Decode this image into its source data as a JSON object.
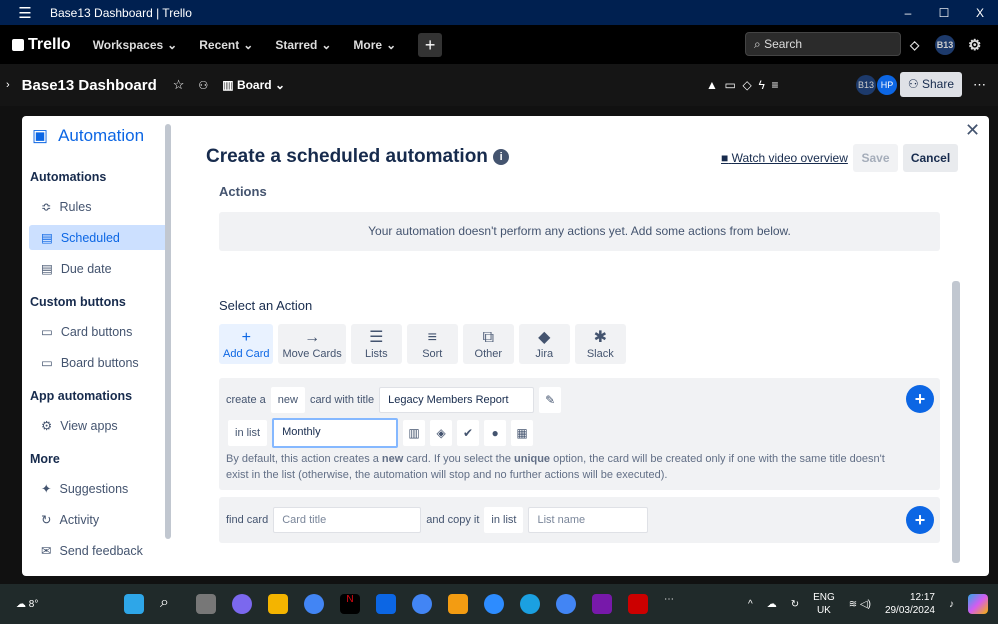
{
  "window": {
    "title": "Base13 Dashboard | Trello",
    "minimize": "–",
    "maximize": "☐",
    "close": "X"
  },
  "topnav": {
    "logo": "Trello",
    "items": [
      "Workspaces",
      "Recent",
      "Starred",
      "More"
    ],
    "search_placeholder": "Search",
    "avatar": "B13"
  },
  "board": {
    "title": "Base13 Dashboard",
    "view": "Board",
    "members": [
      "B13",
      "HP"
    ],
    "share": "Share"
  },
  "sidebar": {
    "title": "Automation",
    "sections": [
      {
        "label": "Automations",
        "items": [
          {
            "label": "Rules",
            "icon": "≎"
          },
          {
            "label": "Scheduled",
            "icon": "▤",
            "active": true
          },
          {
            "label": "Due date",
            "icon": "▤"
          }
        ]
      },
      {
        "label": "Custom buttons",
        "items": [
          {
            "label": "Card buttons",
            "icon": "▭"
          },
          {
            "label": "Board buttons",
            "icon": "▭"
          }
        ]
      },
      {
        "label": "App automations",
        "items": [
          {
            "label": "View apps",
            "icon": "⚙"
          }
        ]
      },
      {
        "label": "More",
        "items": [
          {
            "label": "Suggestions",
            "icon": "✦"
          },
          {
            "label": "Activity",
            "icon": "↻"
          },
          {
            "label": "Send feedback",
            "icon": "✉"
          }
        ]
      }
    ]
  },
  "main": {
    "title": "Create a scheduled automation",
    "watch": "Watch video overview",
    "save": "Save",
    "cancel": "Cancel",
    "actions_heading": "Actions",
    "empty": "Your automation doesn't perform any actions yet. Add some actions from below.",
    "select_heading": "Select an Action",
    "tabs": [
      {
        "label": "Add Card",
        "icon": "+"
      },
      {
        "label": "Move Cards",
        "icon": "→"
      },
      {
        "label": "Lists",
        "icon": "☰"
      },
      {
        "label": "Sort",
        "icon": "≡"
      },
      {
        "label": "Other",
        "icon": "⧉"
      },
      {
        "label": "Jira",
        "icon": "◆"
      },
      {
        "label": "Slack",
        "icon": "✱"
      }
    ],
    "create": {
      "create_a": "create a",
      "new": "new",
      "card_with_title": "card with title",
      "title_value": "Legacy Members Report",
      "in_list": "in list",
      "list_value": "Monthly",
      "desc_1": "By default, this action creates a ",
      "desc_new": "new",
      "desc_2": " card. If you select the ",
      "desc_unique": "unique",
      "desc_3": " option, the card will be created only if one with the same title doesn't exist in the list (otherwise, the automation will stop and no further actions will be executed)."
    },
    "copy": {
      "find_card": "find card",
      "card_placeholder": "Card title",
      "and_copy_it": "and copy it",
      "in_list": "in list",
      "list_placeholder": "List name"
    }
  },
  "taskbar": {
    "weather": "8°",
    "lang": "ENG",
    "region": "UK",
    "time": "12:17",
    "date": "29/03/2024"
  }
}
